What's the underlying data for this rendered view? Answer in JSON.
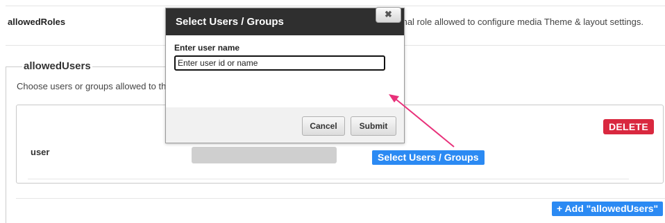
{
  "setting_row": {
    "label": "allowedRoles",
    "description": "mal role allowed to configure media Theme & layout settings."
  },
  "allowed_users": {
    "legend": "allowedUsers",
    "description": "Choose users or groups allowed to them",
    "row": {
      "label": "user",
      "delete_label": "DELETE",
      "select_label": "Select Users / Groups"
    },
    "add_label": "+ Add \"allowedUsers\""
  },
  "modal": {
    "title": "Select Users / Groups",
    "close_icon": "close-icon",
    "close_glyph": "✖",
    "input_label": "Enter user name",
    "input_placeholder": "Enter user id or name",
    "input_value": "",
    "cancel_label": "Cancel",
    "submit_label": "Submit"
  },
  "colors": {
    "delete": "#d9283f",
    "primary": "#2b8af3",
    "modal_header": "#2f2f2f",
    "annotation_arrow": "#e8317a"
  }
}
